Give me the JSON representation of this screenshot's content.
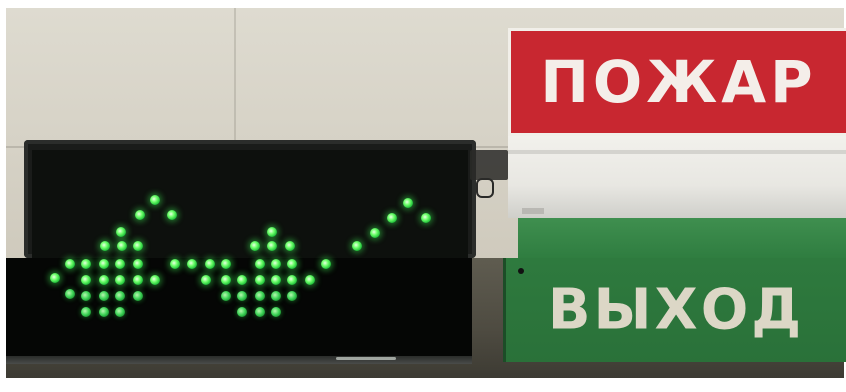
{
  "fire_sign": {
    "text": "ПОЖАР",
    "color": "#c82730"
  },
  "exit_sign": {
    "text": "ВЫХОД",
    "color": "#2e7a3e"
  },
  "led_display": {
    "led_color": "#3ee05a"
  }
}
